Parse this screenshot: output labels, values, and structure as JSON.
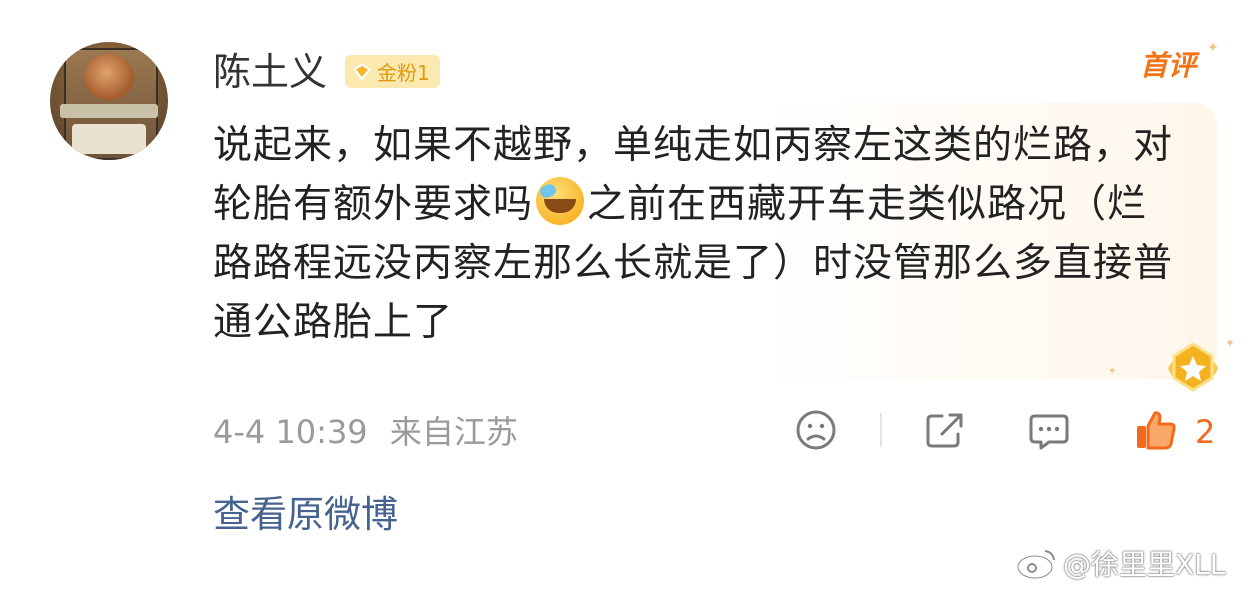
{
  "comment": {
    "author": {
      "name": "陈土义",
      "badge_label": "金粉1"
    },
    "first_comment_label": "首评",
    "text_before_emoji": "说起来，如果不越野，单纯走如丙察左这类的烂路，对轮胎有额外要求吗",
    "emoji_name": "laughing-crying-emoji",
    "text_after_emoji": "之前在西藏开车走类似路况（烂路路程远没丙察左那么长就是了）时没管那么多直接普通公路胎上了",
    "timestamp": "4-4 10:39",
    "location": "来自江苏",
    "like_count": "2"
  },
  "links": {
    "view_original": "查看原微博"
  },
  "watermark": {
    "text": "@徐里里XLL"
  },
  "colors": {
    "accent_orange": "#f27417",
    "link_blue": "#456290",
    "meta_gray": "#9a9a9a",
    "badge_bg": "#fbe9b0"
  }
}
